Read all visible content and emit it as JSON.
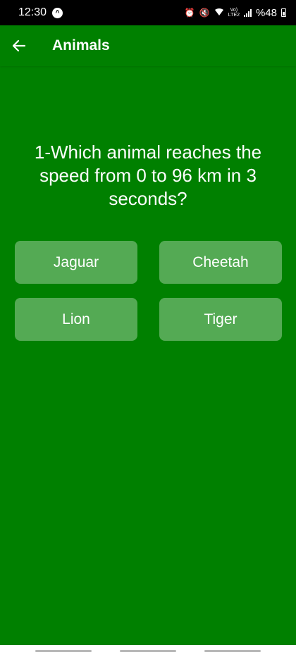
{
  "status_bar": {
    "time": "12:30",
    "app_icon_glyph": "^",
    "lte_top": "Vo)",
    "lte_bottom": "LTE2",
    "battery": "%48"
  },
  "app_bar": {
    "back_icon": "arrow-left-icon",
    "title": "Animals"
  },
  "question": {
    "text": "1-Which animal reaches the speed from 0 to 96 km in 3 seconds?"
  },
  "answers": [
    {
      "label": "Jaguar"
    },
    {
      "label": "Cheetah"
    },
    {
      "label": "Lion"
    },
    {
      "label": "Tiger"
    }
  ],
  "colors": {
    "background": "#008000",
    "answer_button": "rgba(255,255,255,0.33)",
    "text": "#ffffff"
  }
}
